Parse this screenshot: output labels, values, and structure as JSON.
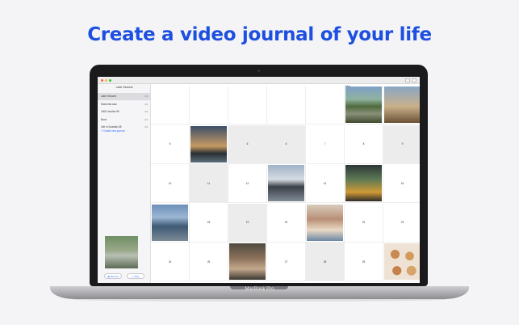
{
  "headline": "Create a video journal of your life",
  "device_label": "MacBook Pro",
  "sidebar": {
    "title": "Later Second",
    "items": [
      {
        "label": "Later Second",
        "selected": true
      },
      {
        "label": "Moments saw",
        "selected": false
      },
      {
        "label": "1000 movies 99",
        "selected": false
      },
      {
        "label": "Nora",
        "selected": false
      },
      {
        "label": "Life in Scandin 48",
        "selected": false
      }
    ],
    "more_glyph": "•••",
    "create_label": "+ Create new journal",
    "record_label": "◉ Record",
    "play_label": "▷ Play"
  },
  "calendar": {
    "month_label": "Mar",
    "row0": [
      {
        "day": "",
        "gray": false
      },
      {
        "day": "",
        "gray": false
      },
      {
        "day": "",
        "gray": false
      },
      {
        "day": "",
        "gray": false
      },
      {
        "day": "",
        "gray": false
      },
      {
        "day": "",
        "gray": false,
        "photo": "waterfall"
      },
      {
        "day": "",
        "gray": false,
        "photo": "portrait-sunset"
      }
    ],
    "rows": [
      [
        {
          "day": "5"
        },
        {
          "day": "",
          "photo": "palm-sunset"
        },
        {
          "day": "6",
          "gray": true
        },
        {
          "day": "6",
          "gray": true
        },
        {
          "day": "7"
        },
        {
          "day": "8"
        },
        {
          "day": "9",
          "gray": true
        }
      ],
      [
        {
          "day": "10"
        },
        {
          "day": "11",
          "gray": true
        },
        {
          "day": "12"
        },
        {
          "day": "",
          "photo": "city-skyline"
        },
        {
          "day": "14"
        },
        {
          "day": "",
          "photo": "graduation"
        },
        {
          "day": "16"
        }
      ],
      [
        {
          "day": "",
          "photo": "waterfront"
        },
        {
          "day": "18"
        },
        {
          "day": "19",
          "gray": true
        },
        {
          "day": "20"
        },
        {
          "day": "",
          "photo": "family-baby"
        },
        {
          "day": "22"
        },
        {
          "day": "23"
        }
      ],
      [
        {
          "day": "24"
        },
        {
          "day": "25"
        },
        {
          "day": "",
          "photo": "selfie-couple"
        },
        {
          "day": "27"
        },
        {
          "day": "28",
          "gray": true
        },
        {
          "day": "29"
        },
        {
          "day": "",
          "photo": "donuts"
        }
      ]
    ]
  }
}
